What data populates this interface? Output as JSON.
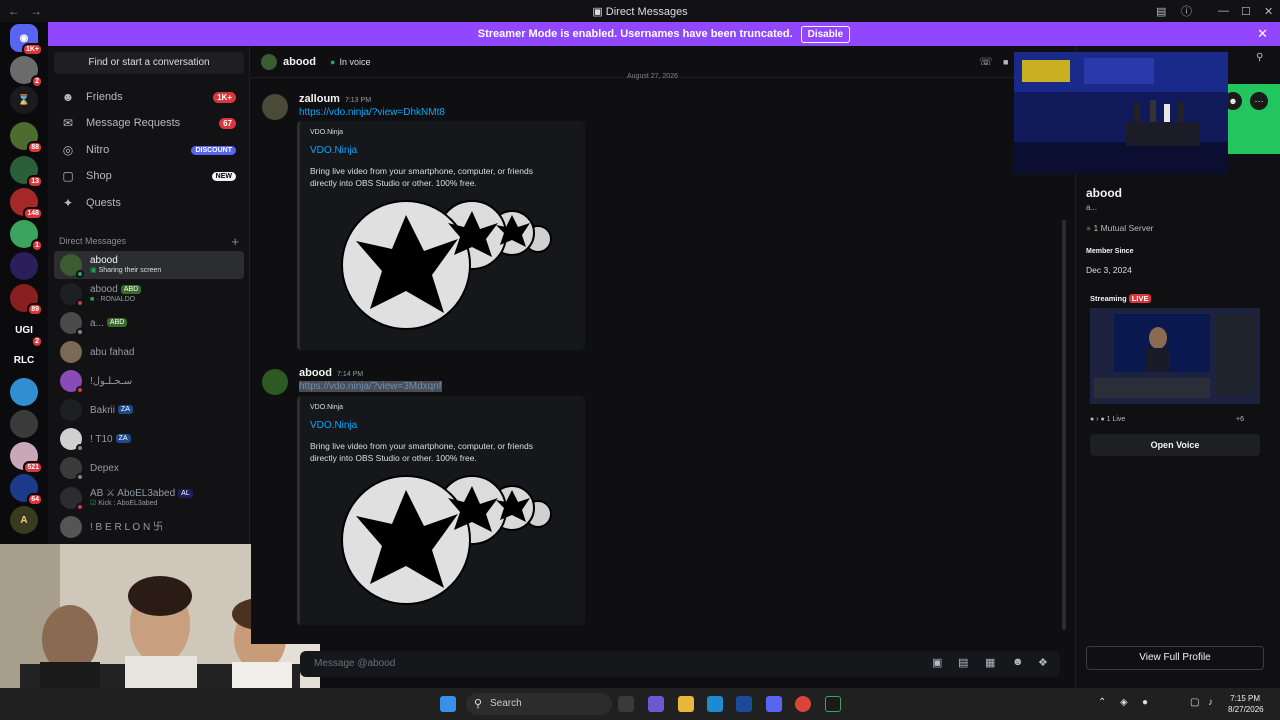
{
  "window": {
    "title": "Direct Messages"
  },
  "banner": {
    "text": "Streamer Mode is enabled. Usernames have been truncated.",
    "disable": "Disable"
  },
  "rail": {
    "badges": [
      "1K+",
      "2",
      "88",
      "13",
      "148",
      "1",
      "89",
      "2",
      "521",
      "64"
    ],
    "text_servers": [
      "UGI",
      "RLC"
    ]
  },
  "sidebar": {
    "find": "Find or start a conversation",
    "nav": [
      {
        "label": "Friends",
        "badge": "1K+",
        "icon": "friends-icon"
      },
      {
        "label": "Message Requests",
        "badge": "67",
        "icon": "mail-icon"
      },
      {
        "label": "Nitro",
        "badge": "DISCOUNT",
        "icon": "nitro-icon"
      },
      {
        "label": "Shop",
        "badge": "NEW",
        "icon": "shop-icon"
      },
      {
        "label": "Quests",
        "badge": "",
        "icon": "quests-icon"
      }
    ],
    "dm_header": "Direct Messages",
    "dms": [
      {
        "name": "abood",
        "sub": "Sharing their screen",
        "tag": ""
      },
      {
        "name": "abood",
        "sub": "RONALDO",
        "tag": "ABD"
      },
      {
        "name": "a...",
        "sub": "",
        "tag": "ABD"
      },
      {
        "name": "abu fahad",
        "sub": "",
        "tag": ""
      },
      {
        "name": "!سـحـلـول",
        "sub": "",
        "tag": ""
      },
      {
        "name": "Bakrii",
        "sub": "",
        "tag": "ZA"
      },
      {
        "name": "! T10",
        "sub": "",
        "tag": "ZA"
      },
      {
        "name": "Depex",
        "sub": "",
        "tag": ""
      },
      {
        "name": "AB ⚔ AboEL3abed",
        "sub": "Kick : AboEL3abed",
        "tag": "AL"
      },
      {
        "name": "! B E R L O N 卐",
        "sub": "",
        "tag": ""
      }
    ]
  },
  "chat": {
    "header_name": "abood",
    "header_status": "In voice",
    "date_divider": "August 27, 2026",
    "messages": [
      {
        "author": "zalloum",
        "time": "7:13 PM",
        "link": "https://vdo.ninja/?view=DhkNMt8"
      },
      {
        "author": "abood",
        "time": "7:14 PM",
        "link": "https://vdo.ninja/?view=3Mdxqnf"
      }
    ],
    "embed": {
      "provider": "VDO.Ninja",
      "title": "VDO.Ninja",
      "description": "Bring live video from your smartphone, computer, or friends directly into OBS Studio or other. 100% free."
    },
    "composer_placeholder": "Message @abood"
  },
  "profile": {
    "name": "abood",
    "sub": "a...",
    "mutual": "1 Mutual Server",
    "member_since_label": "Member Since",
    "member_since": "Dec 3, 2024",
    "streaming_label": "Streaming",
    "live": "LIVE",
    "live_count": "1 Live",
    "extra_count": "+6",
    "open_voice": "Open Voice",
    "view_full": "View Full Profile"
  },
  "taskbar": {
    "search": "Search",
    "time": "7:15 PM",
    "date": "8/27/2026"
  },
  "colors": {
    "accent": "#9147ff",
    "link": "#00a8fc",
    "online": "#23a55a",
    "danger": "#da373c",
    "blurple": "#5865f2"
  }
}
